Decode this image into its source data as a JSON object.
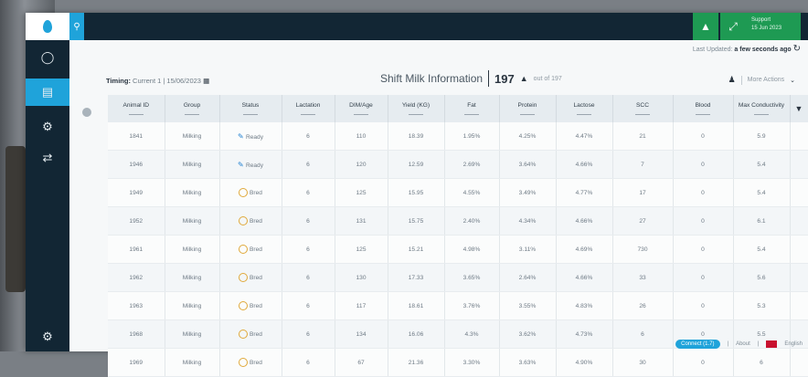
{
  "header": {
    "user_line1": "Support",
    "user_line2": "15 Jun 2023"
  },
  "content": {
    "last_updated_label": "Last Updated:",
    "last_updated_value": "a few seconds ago",
    "timing_label": "Timing:",
    "timing_value": "Current 1 | 15/06/2023",
    "page_title": "Shift Milk Information",
    "count": "197",
    "out_of": "out of 197",
    "more_actions": "More Actions"
  },
  "table": {
    "columns": [
      "Animal ID",
      "Group",
      "Status",
      "Lactation",
      "DIM/Age",
      "Yield (KG)",
      "Fat",
      "Protein",
      "Lactose",
      "SCC",
      "Blood",
      "Max Conductivity"
    ],
    "rows": [
      [
        "1841",
        "Milking",
        "Ready",
        "6",
        "110",
        "18.39",
        "1.95%",
        "4.25%",
        "4.47%",
        "21",
        "0",
        "5.9"
      ],
      [
        "1946",
        "Milking",
        "Ready",
        "6",
        "120",
        "12.59",
        "2.69%",
        "3.64%",
        "4.66%",
        "7",
        "0",
        "5.4"
      ],
      [
        "1949",
        "Milking",
        "Bred",
        "6",
        "125",
        "15.95",
        "4.55%",
        "3.49%",
        "4.77%",
        "17",
        "0",
        "5.4"
      ],
      [
        "1952",
        "Milking",
        "Bred",
        "6",
        "131",
        "15.75",
        "2.40%",
        "4.34%",
        "4.66%",
        "27",
        "0",
        "6.1"
      ],
      [
        "1961",
        "Milking",
        "Bred",
        "6",
        "125",
        "15.21",
        "4.98%",
        "3.11%",
        "4.69%",
        "730",
        "0",
        "5.4"
      ],
      [
        "1962",
        "Milking",
        "Bred",
        "6",
        "130",
        "17.33",
        "3.65%",
        "2.64%",
        "4.66%",
        "33",
        "0",
        "5.6"
      ],
      [
        "1963",
        "Milking",
        "Bred",
        "6",
        "117",
        "18.61",
        "3.76%",
        "3.55%",
        "4.83%",
        "26",
        "0",
        "5.3"
      ],
      [
        "1968",
        "Milking",
        "Bred",
        "6",
        "134",
        "16.06",
        "4.3%",
        "3.62%",
        "4.73%",
        "6",
        "0",
        "5.5"
      ],
      [
        "1969",
        "Milking",
        "Bred",
        "6",
        "67",
        "21.36",
        "3.30%",
        "3.63%",
        "4.90%",
        "30",
        "0",
        "6"
      ]
    ]
  },
  "footer": {
    "connect": "Connect (1.7)",
    "about": "About",
    "language": "English"
  }
}
